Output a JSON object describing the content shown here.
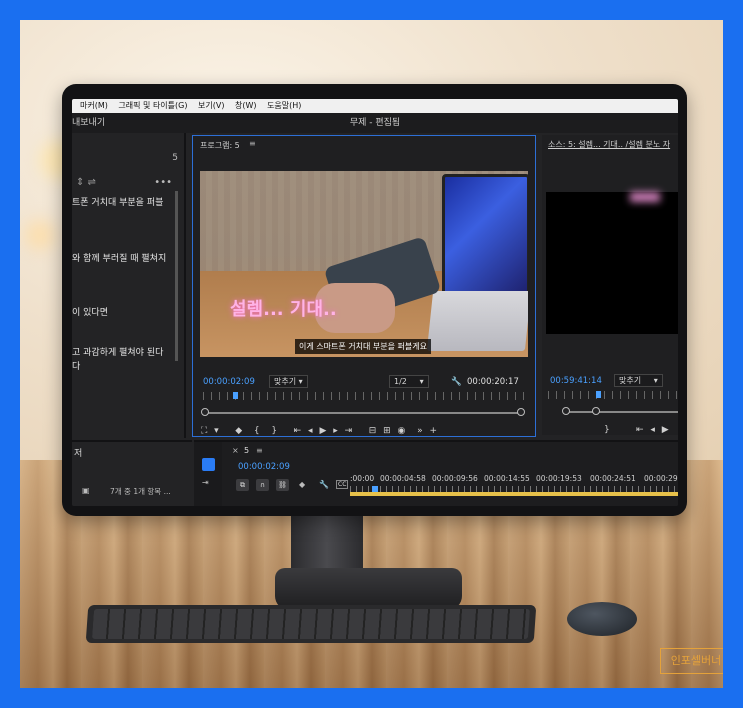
{
  "menu": [
    "마커(M)",
    "그래픽 및 타이틀(G)",
    "보기(V)",
    "창(W)",
    "도움말(H)"
  ],
  "titlebar": {
    "left": "내보내기",
    "center": "무제 - 편집됨"
  },
  "left_panel": {
    "count": "5",
    "lines": [
      "트폰 거치대 부분을 퍼블",
      "와 함께 부러질 때 펼쳐지",
      "이 있다면",
      "고 과감하게 펼쳐야 된다",
      "다"
    ],
    "bottom_label": "저",
    "footer": "7개 중 1개 항목 ..."
  },
  "program": {
    "title": "프로그램: 5",
    "subtitle": "이게 스마트폰 거치대 부분을 퍼블게요",
    "timecode": "00:00:02:09",
    "fit": "맞추기",
    "resolution": "1/2",
    "duration": "00:00:20:17"
  },
  "source": {
    "title": "소스: 5: 설렘... 기대.. /설렘 분노 자",
    "timecode": "00:59:41:14",
    "fit": "맞추기"
  },
  "timeline": {
    "tab": "5",
    "timecode": "00:00:02:09",
    "ruler": [
      ":00:00",
      "00:00:04:58",
      "00:00:09:56",
      "00:00:14:55",
      "00:00:19:53",
      "00:00:24:51",
      "00:00:29"
    ]
  },
  "watermark": "인포셀버너",
  "colors": {
    "frame": "#1a6ff0",
    "accent": "#4aa0ff",
    "track": "#e7c14a"
  }
}
